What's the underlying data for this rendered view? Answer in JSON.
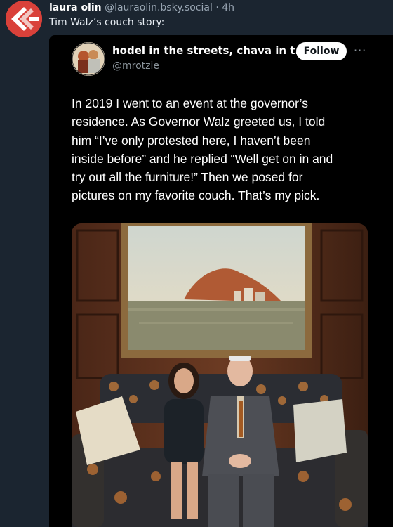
{
  "post": {
    "author_name": "laura olin",
    "author_handle": "@lauraolin.bsky.social",
    "separator": "·",
    "age": "4h",
    "text": "Tim Walz’s couch story:"
  },
  "embed": {
    "author_name": "hodel in the streets, chava in t...",
    "author_handle": "@mrotzie",
    "follow_label": "Follow",
    "more_label": "···",
    "tweet_lines": [
      "In 2019 I went to an event at the governor’s",
      "residence. As Governor Walz greeted us, I told",
      "him “I’ve only protested here, I haven’t been",
      "inside before” and he replied “Well get on in and",
      "try out all the furniture!” Then we posed for",
      "pictures on my favorite couch. That’s my pick."
    ]
  },
  "colors": {
    "background": "#1b2530",
    "avatar_red": "#d9413a",
    "embed_background": "#000000"
  },
  "icons": {
    "post_avatar": "bluesky-avatar-chevron",
    "embed_avatar": "profile-photo",
    "photo": "two-people-on-floral-couch-under-landscape-painting"
  }
}
